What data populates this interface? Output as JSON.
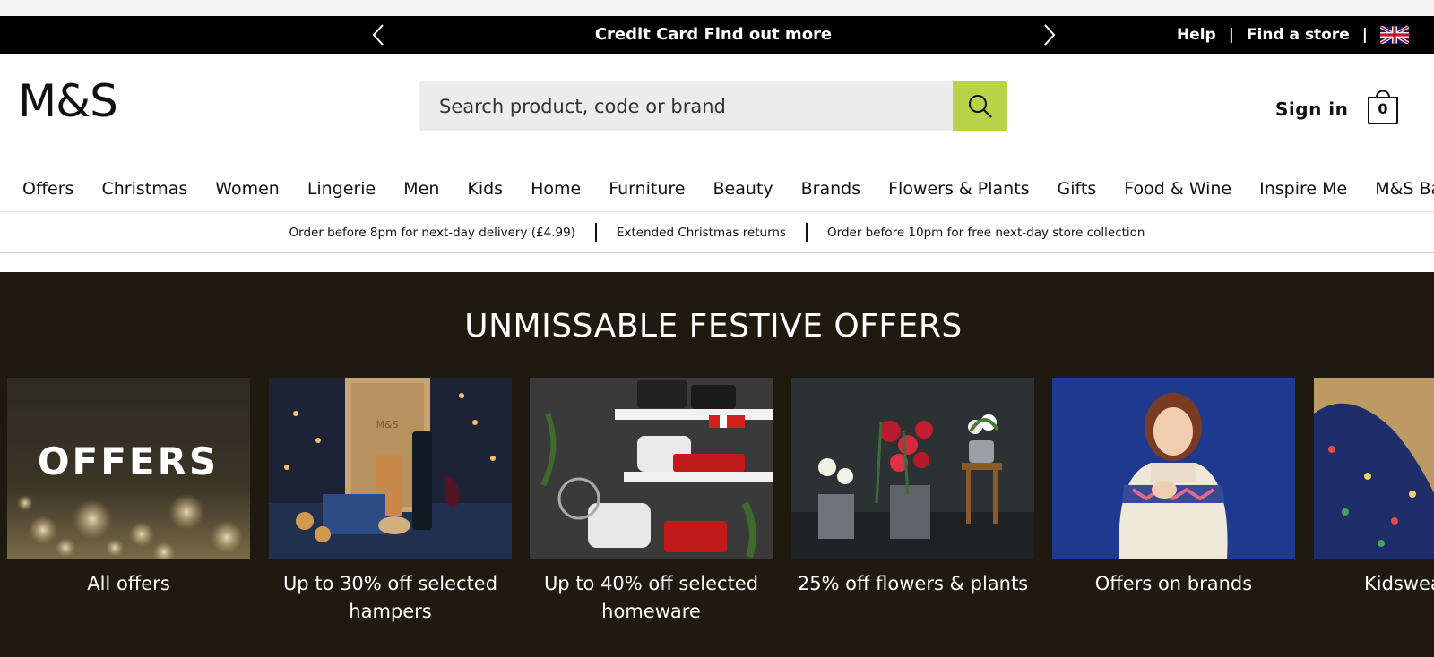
{
  "promo": {
    "text": "Credit Card Find out more"
  },
  "utility": {
    "help": "Help",
    "separator": "|",
    "find_store": "Find a store",
    "flag_icon": "uk-flag-icon"
  },
  "header": {
    "logo": "M&S",
    "search_placeholder": "Search product, code or brand",
    "sign_in": "Sign in",
    "basket_count": "0"
  },
  "nav": [
    "Offers",
    "Christmas",
    "Women",
    "Lingerie",
    "Men",
    "Kids",
    "Home",
    "Furniture",
    "Beauty",
    "Brands",
    "Flowers & Plants",
    "Gifts",
    "Food & Wine",
    "Inspire Me",
    "M&S Bank"
  ],
  "usp": [
    "Order before 8pm for next-day delivery (£4.99)",
    "Extended Christmas returns",
    "Order before 10pm for free next-day store collection"
  ],
  "offers": {
    "heading": "UNMISSABLE FESTIVE OFFERS",
    "cards": [
      {
        "label": "All offers",
        "image_text": "OFFERS"
      },
      {
        "label": "Up to 30% off selected hampers",
        "image_text": "M&S"
      },
      {
        "label": "Up to 40% off selected homeware"
      },
      {
        "label": "25% off flowers & plants"
      },
      {
        "label": "Offers on brands"
      },
      {
        "label": "Kidswear"
      }
    ]
  },
  "colors": {
    "promo_bg": "#000000",
    "search_button": "#b8d24a",
    "offers_bg": "#1f1a0f"
  }
}
